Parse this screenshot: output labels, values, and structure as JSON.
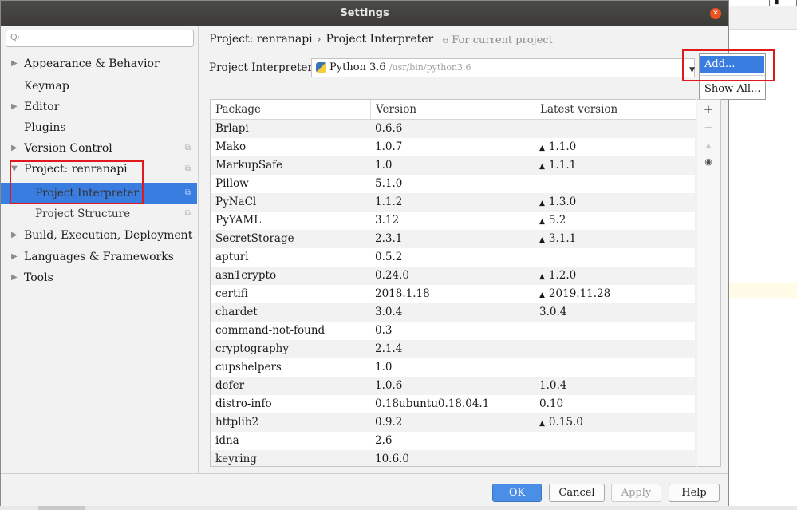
{
  "window": {
    "title": "Settings"
  },
  "sidebar": {
    "search_placeholder": "",
    "items": [
      {
        "label": "Appearance & Behavior",
        "level": 0,
        "expanded": false,
        "has_arrow": true
      },
      {
        "label": "Keymap",
        "level": 0,
        "has_arrow": false
      },
      {
        "label": "Editor",
        "level": 0,
        "expanded": false,
        "has_arrow": true
      },
      {
        "label": "Plugins",
        "level": 0,
        "has_arrow": false
      },
      {
        "label": "Version Control",
        "level": 0,
        "expanded": false,
        "has_arrow": true,
        "project_scoped": true
      },
      {
        "label": "Project: renranapi",
        "level": 0,
        "expanded": true,
        "has_arrow": true,
        "project_scoped": true
      },
      {
        "label": "Project Interpreter",
        "level": 1,
        "selected": true,
        "project_scoped": true
      },
      {
        "label": "Project Structure",
        "level": 1,
        "project_scoped": true
      },
      {
        "label": "Build, Execution, Deployment",
        "level": 0,
        "expanded": false,
        "has_arrow": true
      },
      {
        "label": "Languages & Frameworks",
        "level": 0,
        "expanded": false,
        "has_arrow": true
      },
      {
        "label": "Tools",
        "level": 0,
        "expanded": false,
        "has_arrow": true
      }
    ]
  },
  "breadcrumb": {
    "project": "Project: renranapi",
    "separator": "›",
    "page": "Project Interpreter",
    "scope_note": "For current project"
  },
  "interpreter": {
    "label": "Project Interpreter:",
    "name": "Python 3.6",
    "path": "/usr/bin/python3.6"
  },
  "popup_menu": {
    "items": [
      "Add...",
      "Show All..."
    ],
    "highlighted": "Add..."
  },
  "packages": {
    "columns": [
      "Package",
      "Version",
      "Latest version"
    ],
    "rows": [
      {
        "name": "Brlapi",
        "version": "0.6.6",
        "latest": "",
        "upgrade": false
      },
      {
        "name": "Mako",
        "version": "1.0.7",
        "latest": "1.1.0",
        "upgrade": true
      },
      {
        "name": "MarkupSafe",
        "version": "1.0",
        "latest": "1.1.1",
        "upgrade": true
      },
      {
        "name": "Pillow",
        "version": "5.1.0",
        "latest": "",
        "upgrade": false
      },
      {
        "name": "PyNaCl",
        "version": "1.1.2",
        "latest": "1.3.0",
        "upgrade": true
      },
      {
        "name": "PyYAML",
        "version": "3.12",
        "latest": "5.2",
        "upgrade": true
      },
      {
        "name": "SecretStorage",
        "version": "2.3.1",
        "latest": "3.1.1",
        "upgrade": true
      },
      {
        "name": "apturl",
        "version": "0.5.2",
        "latest": "",
        "upgrade": false
      },
      {
        "name": "asn1crypto",
        "version": "0.24.0",
        "latest": "1.2.0",
        "upgrade": true
      },
      {
        "name": "certifi",
        "version": "2018.1.18",
        "latest": "2019.11.28",
        "upgrade": true
      },
      {
        "name": "chardet",
        "version": "3.0.4",
        "latest": "3.0.4",
        "upgrade": false
      },
      {
        "name": "command-not-found",
        "version": "0.3",
        "latest": "",
        "upgrade": false
      },
      {
        "name": "cryptography",
        "version": "2.1.4",
        "latest": "",
        "upgrade": false
      },
      {
        "name": "cupshelpers",
        "version": "1.0",
        "latest": "",
        "upgrade": false
      },
      {
        "name": "defer",
        "version": "1.0.6",
        "latest": "1.0.4",
        "upgrade": false
      },
      {
        "name": "distro-info",
        "version": "0.18ubuntu0.18.04.1",
        "latest": "0.10",
        "upgrade": false
      },
      {
        "name": "httplib2",
        "version": "0.9.2",
        "latest": "0.15.0",
        "upgrade": true
      },
      {
        "name": "idna",
        "version": "2.6",
        "latest": "",
        "upgrade": false
      },
      {
        "name": "keyring",
        "version": "10.6.0",
        "latest": "",
        "upgrade": false
      }
    ]
  },
  "table_tools": {
    "add": "+",
    "remove": "−",
    "upgrade": "▲",
    "show_early": "👁"
  },
  "buttons": {
    "ok": "OK",
    "cancel": "Cancel",
    "apply": "Apply",
    "help": "Help"
  },
  "colors": {
    "selection": "#3a7de0",
    "highlight_box": "#e0191c",
    "titlebar": "#3c3b37",
    "close": "#e95420"
  }
}
